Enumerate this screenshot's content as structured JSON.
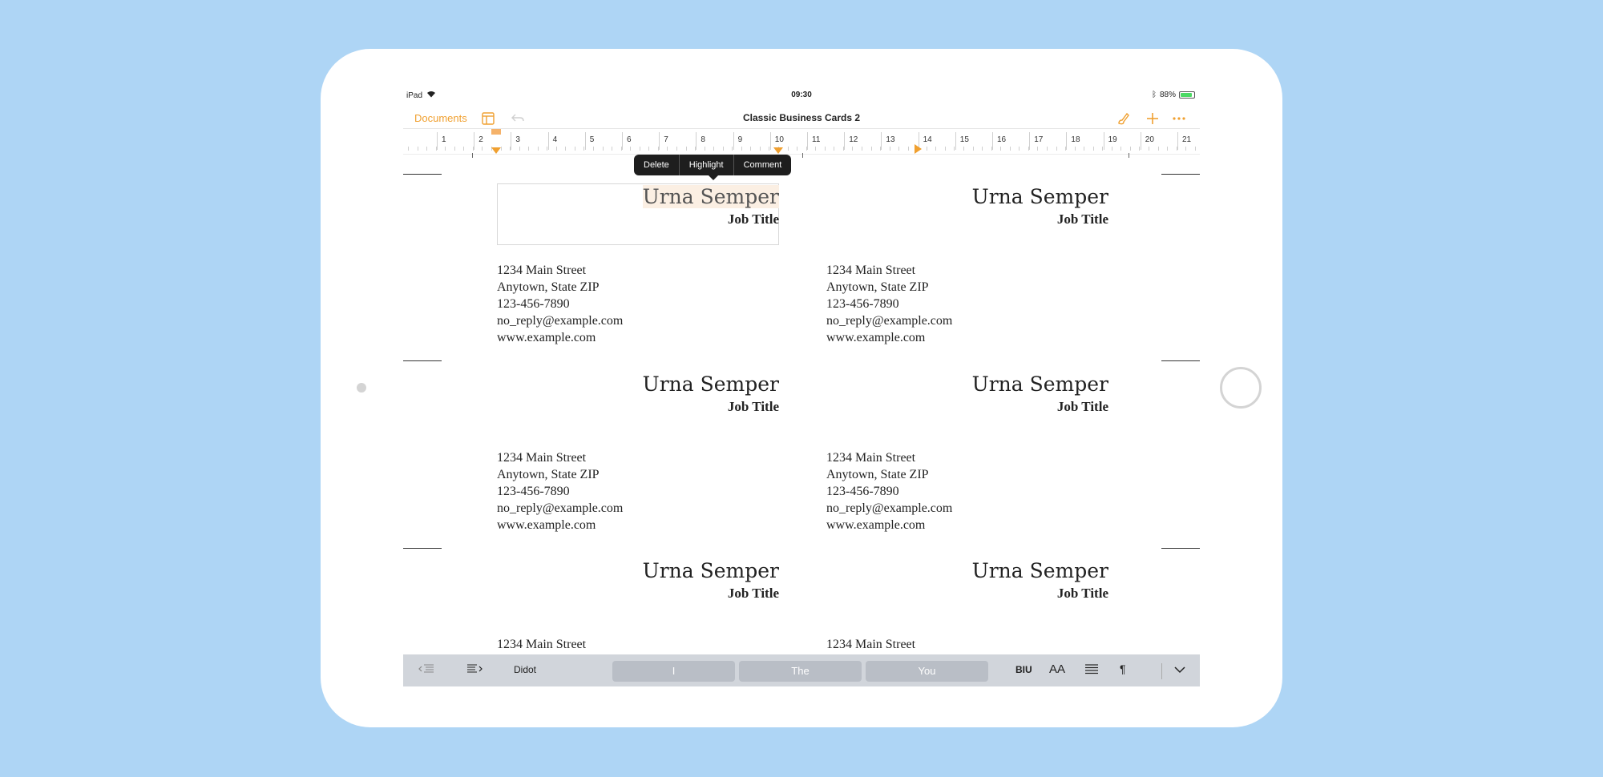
{
  "status_bar": {
    "device": "iPad",
    "time": "09:30",
    "battery": "88%"
  },
  "toolbar": {
    "documents_label": "Documents",
    "title": "Classic Business Cards 2"
  },
  "ruler": {
    "numbers": [
      "1",
      "2",
      "3",
      "4",
      "5",
      "6",
      "7",
      "8",
      "9",
      "10",
      "11",
      "12",
      "13",
      "14",
      "15",
      "16",
      "17",
      "18",
      "19",
      "20",
      "21"
    ]
  },
  "popup": {
    "delete": "Delete",
    "highlight": "Highlight",
    "comment": "Comment"
  },
  "cards": [
    {
      "name": "Urna Semper",
      "job": "Job Title",
      "address": "1234 Main Street",
      "city": "Anytown, State ZIP",
      "phone": "123-456-7890",
      "email": "no_reply@example.com",
      "web": "www.example.com"
    },
    {
      "name": "Urna Semper",
      "job": "Job Title",
      "address": "1234 Main Street",
      "city": "Anytown, State ZIP",
      "phone": "123-456-7890",
      "email": "no_reply@example.com",
      "web": "www.example.com"
    },
    {
      "name": "Urna Semper",
      "job": "Job Title",
      "address": "1234 Main Street",
      "city": "Anytown, State ZIP",
      "phone": "123-456-7890",
      "email": "no_reply@example.com",
      "web": "www.example.com"
    },
    {
      "name": "Urna Semper",
      "job": "Job Title",
      "address": "1234 Main Street",
      "city": "Anytown, State ZIP",
      "phone": "123-456-7890",
      "email": "no_reply@example.com",
      "web": "www.example.com"
    },
    {
      "name": "Urna Semper",
      "job": "Job Title",
      "address": "1234 Main Street"
    },
    {
      "name": "Urna Semper",
      "job": "Job Title",
      "address": "1234 Main Street"
    }
  ],
  "keyboard_bar": {
    "font": "Didot",
    "suggestions": [
      "I",
      "The",
      "You"
    ],
    "biu": "BIU",
    "font_size": "AA",
    "paragraph": "¶"
  },
  "colors": {
    "accent": "#f0a030",
    "background": "#aed5f5"
  }
}
